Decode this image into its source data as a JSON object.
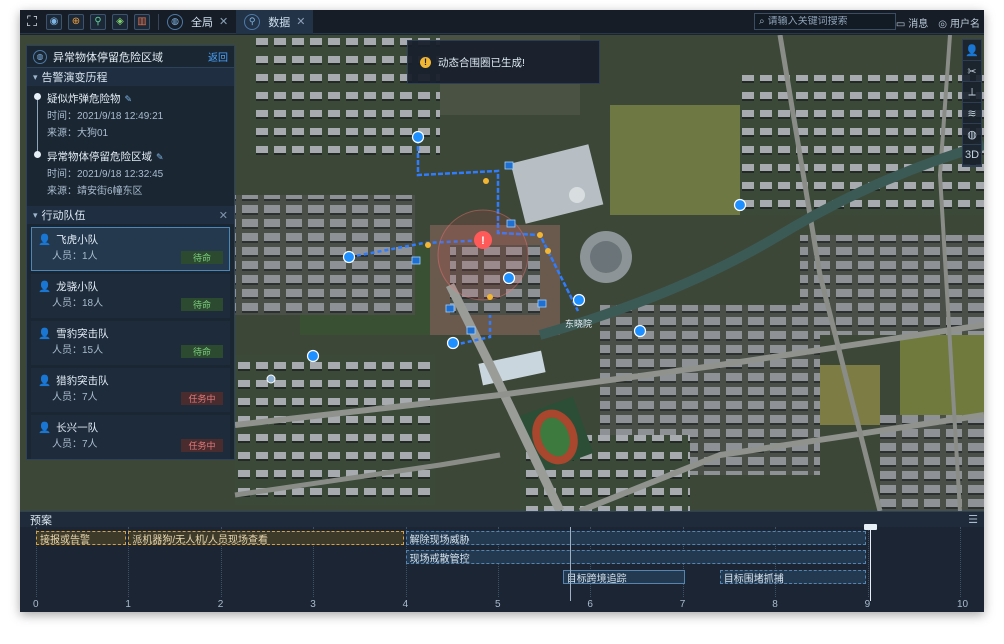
{
  "topbar": {
    "tabs": [
      {
        "label": "全局",
        "icon": "globe-icon"
      },
      {
        "label": "数据",
        "icon": "network-icon"
      }
    ],
    "search_placeholder": "请输入关键词搜索",
    "message_label": "消息",
    "user_label": "用户名"
  },
  "panel": {
    "title": "异常物体停留危险区域",
    "back_label": "返回",
    "history_title": "告警演变历程",
    "history": [
      {
        "title": "疑似炸弹危险物",
        "time": "时间：2021/9/18 12:49:21",
        "source": "来源：大狗01"
      },
      {
        "title": "异常物体停留危险区域",
        "time": "时间：2021/9/18 12:32:45",
        "source": "来源：靖安街6幢东区"
      }
    ],
    "teams_title": "行动队伍",
    "teams": [
      {
        "name": "飞虎小队",
        "people": "人员：1人",
        "status": "待命",
        "kind": "wait"
      },
      {
        "name": "龙骁小队",
        "people": "人员：18人",
        "status": "待命",
        "kind": "wait"
      },
      {
        "name": "雪豹突击队",
        "people": "人员：15人",
        "status": "待命",
        "kind": "wait"
      },
      {
        "name": "猎豹突击队",
        "people": "人员：7人",
        "status": "任务中",
        "kind": "task"
      },
      {
        "name": "长兴一队",
        "people": "人员：7人",
        "status": "任务中",
        "kind": "task"
      }
    ]
  },
  "toast": {
    "text": "动态合围圈已生成!"
  },
  "map": {
    "place_label": "东晓院"
  },
  "right_tools": [
    "person-icon",
    "scissors-icon",
    "ruler-icon",
    "layers-icon",
    "compass-icon",
    "3D"
  ],
  "timeline": {
    "title": "预案",
    "ticks": [
      "0",
      "1",
      "2",
      "3",
      "4",
      "5",
      "6",
      "7",
      "8",
      "9",
      "10"
    ],
    "bars": [
      {
        "label": "接报或告警",
        "start": 0,
        "end": 1,
        "row": 0,
        "style": "orange"
      },
      {
        "label": "派机器狗/无人机/人员现场查看",
        "start": 1,
        "end": 4,
        "row": 0,
        "style": "orange"
      },
      {
        "label": "解除现场威胁",
        "start": 4,
        "end": 9,
        "row": 0,
        "style": "blue"
      },
      {
        "label": "现场戒散管控",
        "start": 4,
        "end": 9,
        "row": 1,
        "style": "blue"
      },
      {
        "label": "目标跨境追踪",
        "start": 5.7,
        "end": 7.05,
        "row": 2,
        "style": "solid"
      },
      {
        "label": "目标围堵抓捕",
        "start": 7.4,
        "end": 9,
        "row": 2,
        "style": "blue"
      }
    ]
  }
}
